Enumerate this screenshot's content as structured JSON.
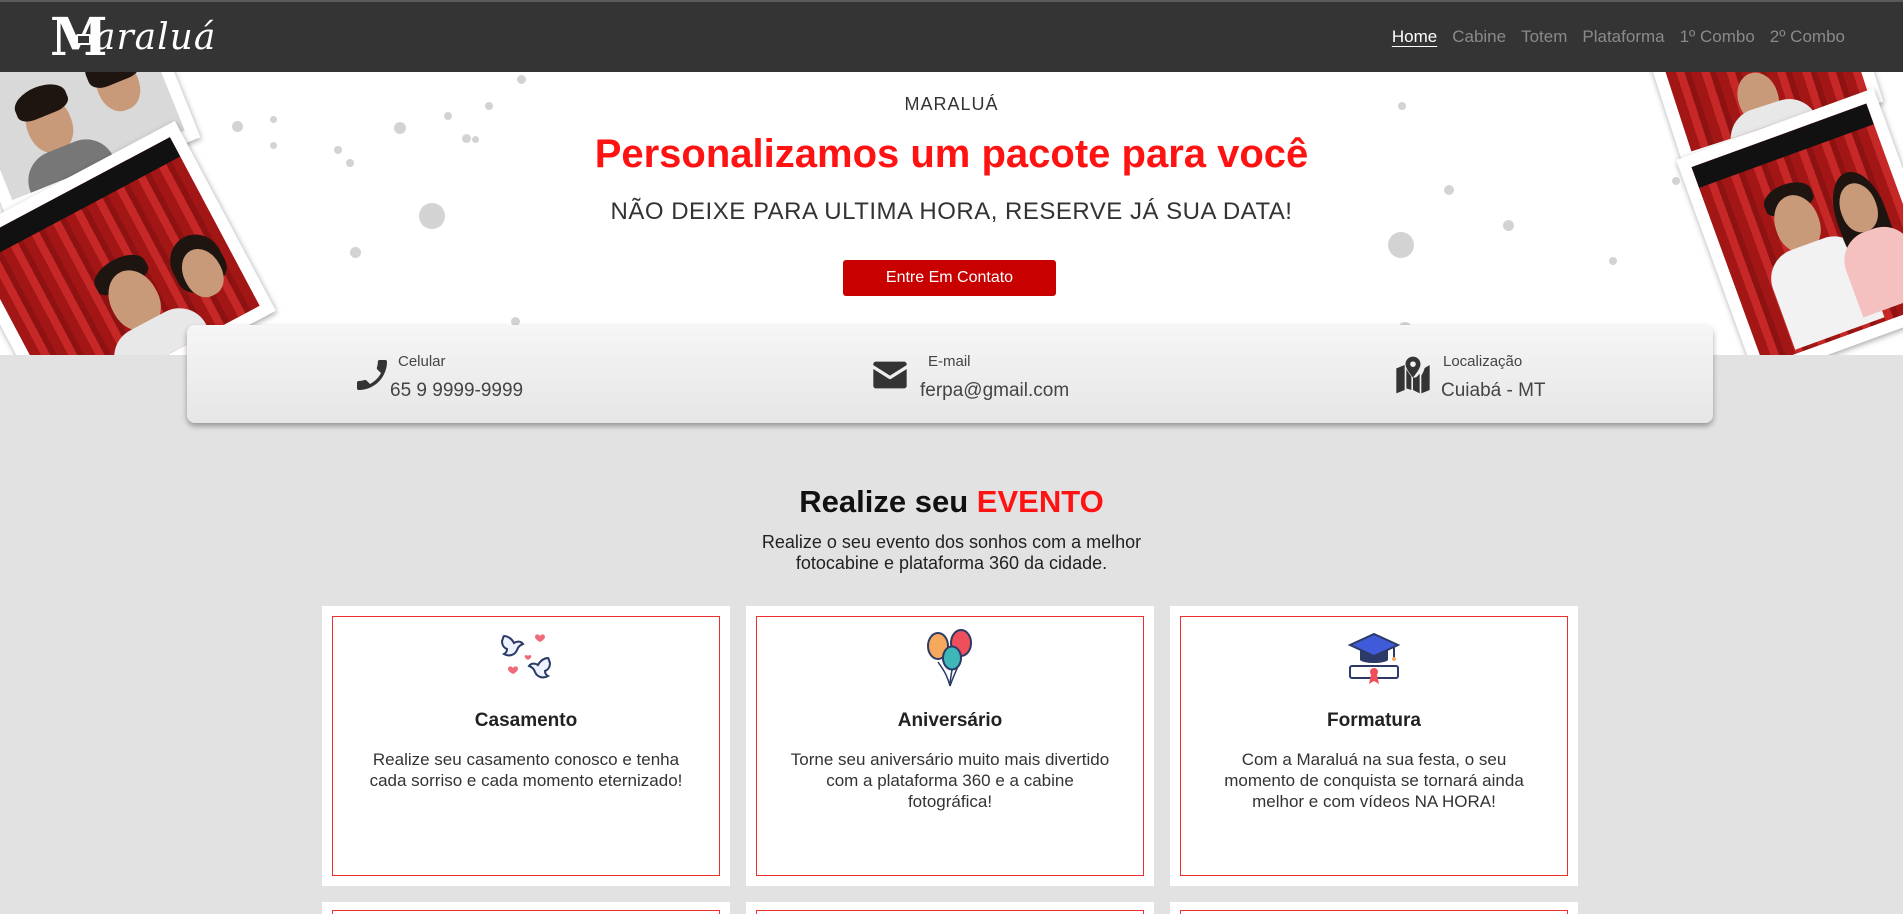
{
  "navbar": {
    "logo_initial": "M",
    "logo_text": "araluá",
    "links": [
      "Home",
      "Cabine",
      "Totem",
      "Plataforma",
      "1º Combo",
      "2º Combo"
    ],
    "active_link": "Home"
  },
  "hero": {
    "brand": "MARALUÁ",
    "title": "Personalizamos um pacote para você",
    "subtitle": "NÃO DEIXE PARA ULTIMA HORA, RESERVE JÁ SUA DATA!",
    "cta_label": "Entre Em Contato"
  },
  "contact": {
    "phone": {
      "label": "Celular",
      "value": "65 9 9999-9999",
      "icon": "phone-icon"
    },
    "email": {
      "label": "E-mail",
      "value": "ferpa@gmail.com",
      "icon": "envelope-icon"
    },
    "location": {
      "label": "Localização",
      "value": "Cuiabá - MT",
      "icon": "map-pin-icon"
    }
  },
  "events": {
    "title_prefix": "Realize seu",
    "title_highlight": "EVENTO",
    "description_line1": "Realize o seu evento dos sonhos com a melhor",
    "description_line2": "fotocabine e plataforma 360 da cidade.",
    "cards": [
      {
        "title": "Casamento",
        "text": "Realize seu casamento conosco e tenha cada sorriso e cada momento eternizado!",
        "icon": "doves-hearts-icon"
      },
      {
        "title": "Aniversário",
        "text": "Torne seu aniversário muito mais divertido com a plataforma 360 e a cabine fotográfica!",
        "icon": "balloons-icon"
      },
      {
        "title": "Formatura",
        "text": "Com a Maraluá na sua festa, o seu momento de conquista se tornará ainda melhor e com vídeos NA HORA!",
        "icon": "graduation-cap-icon"
      }
    ]
  },
  "colors": {
    "brand_red": "#ff1212",
    "button_red": "#c80000",
    "navbar_bg": "#343434",
    "page_bg": "#e2e2e2"
  }
}
